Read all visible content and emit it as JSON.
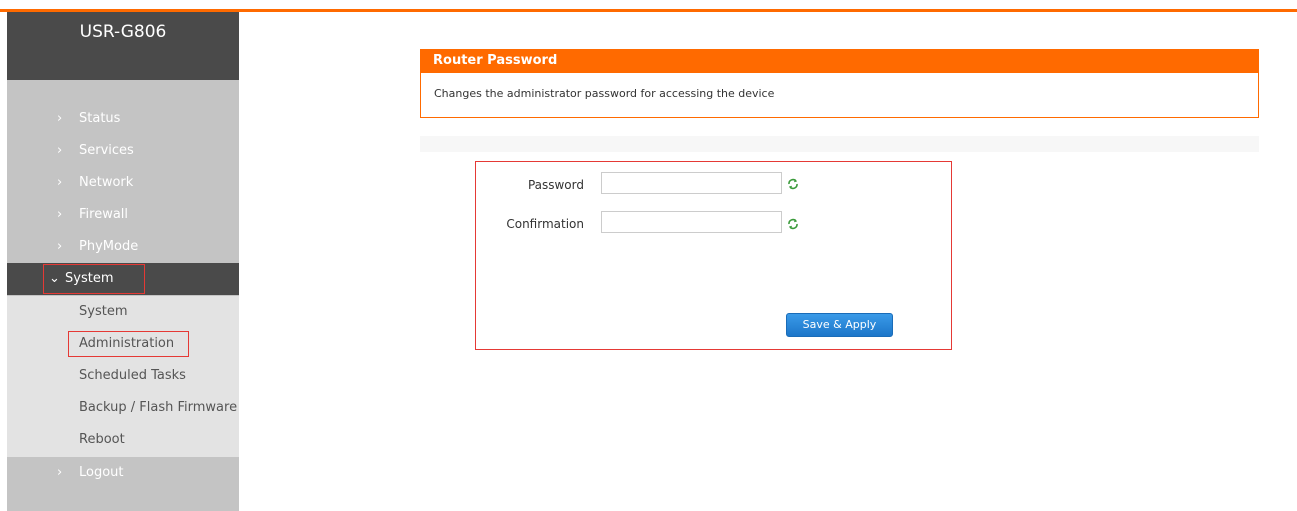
{
  "sidebar": {
    "brand": "USR-G806",
    "items": [
      {
        "label": "Status"
      },
      {
        "label": "Services"
      },
      {
        "label": "Network"
      },
      {
        "label": "Firewall"
      },
      {
        "label": "PhyMode"
      },
      {
        "label": "System"
      }
    ],
    "submenu": [
      {
        "label": "System"
      },
      {
        "label": "Administration"
      },
      {
        "label": "Scheduled Tasks"
      },
      {
        "label": "Backup / Flash Firmware"
      },
      {
        "label": "Reboot"
      }
    ],
    "logout": "Logout"
  },
  "panel": {
    "title": "Router Password",
    "description": "Changes the administrator password for accessing the device"
  },
  "form": {
    "password_label": "Password",
    "password_value": "",
    "confirmation_label": "Confirmation",
    "confirmation_value": "",
    "save_label": "Save & Apply"
  },
  "colors": {
    "accent": "#ff6a00",
    "highlight": "#e53935",
    "button": "#1c76c9"
  }
}
